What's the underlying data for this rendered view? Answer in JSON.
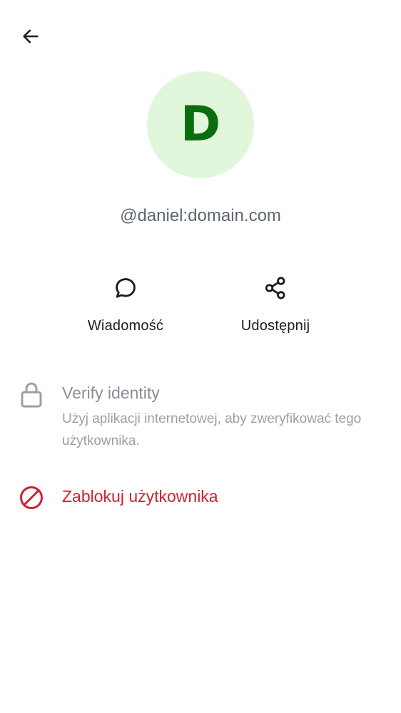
{
  "header": {
    "back_icon": "arrow-left-icon"
  },
  "profile": {
    "avatar_letter": "D",
    "avatar_bg": "#e0f7dc",
    "avatar_fg": "#0a6e0f",
    "user_id": "@daniel:domain.com"
  },
  "actions": [
    {
      "icon": "chat-bubble-icon",
      "label": "Wiadomość"
    },
    {
      "icon": "share-icon",
      "label": "Udostępnij"
    }
  ],
  "verify": {
    "icon": "lock-icon",
    "title": "Verify identity",
    "description": "Użyj aplikacji internetowej, aby zweryfikować tego użytkownika."
  },
  "block": {
    "icon": "block-icon",
    "label": "Zablokuj użytkownika",
    "color": "#d1202f"
  }
}
